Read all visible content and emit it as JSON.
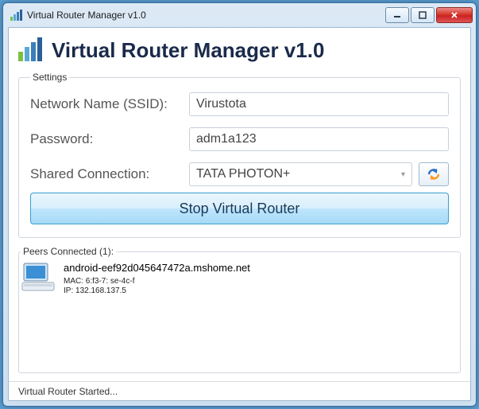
{
  "window": {
    "title": "Virtual Router Manager v1.0"
  },
  "header": {
    "title": "Virtual Router Manager v1.0"
  },
  "settings": {
    "legend": "Settings",
    "ssid_label": "Network Name (SSID):",
    "ssid_value": "Virustota",
    "password_label": "Password:",
    "password_value": "adm1a123",
    "shared_label": "Shared Connection:",
    "shared_value": "TATA PHOTON+",
    "main_button": "Stop Virtual Router"
  },
  "peers": {
    "legend": "Peers Connected (1):",
    "items": [
      {
        "name": "android-eef92d045647472a.mshome.net",
        "mac": "MAC: 6:f3-7: se-4c-f",
        "ip": "IP: 132.168.137.5"
      }
    ]
  },
  "status": {
    "text": "Virtual Router Started..."
  }
}
